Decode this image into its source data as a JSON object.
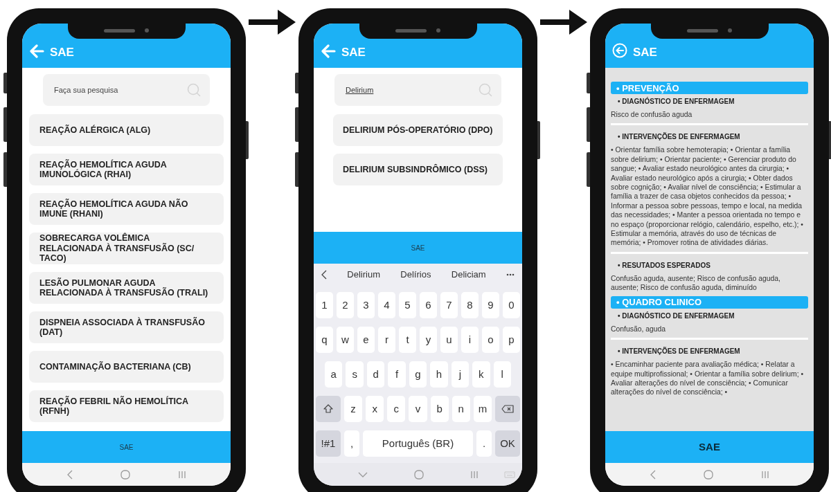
{
  "phones": [
    {
      "kind": "search_list",
      "header": {
        "title": "SAE"
      },
      "search": {
        "placeholder": "Faça sua pesquisa"
      },
      "items": [
        "REAÇÃO ALÉRGICA (ALG)",
        "REAÇÃO HEMOLÍTICA AGUDA IMUNOLÓGICA (RHAI)",
        "REAÇÃO HEMOLÍTICA AGUDA NÃO IMUNE (RHANI)",
        "SOBRECARGA VOLÊMICA RELACIONADA À TRANSFUSÃO (SC/ TACO)",
        "LESÃO PULMONAR AGUDA RELACIONADA À TRANSFUSÃO (TRALI)",
        "DISPNEIA ASSOCIADA À TRANSFUSÃO (DAT)",
        "CONTAMINAÇÃO BACTERIANA (CB)",
        "REAÇÃO FEBRIL NÃO HEMOLÍTICA (RFNH)"
      ],
      "bottom_bar": {
        "label": "SAE"
      }
    },
    {
      "kind": "search_keyboard",
      "header": {
        "title": "SAE"
      },
      "search": {
        "value": "Delirium"
      },
      "items": [
        "DELIRIUM PÓS-OPERATÓRIO (DPO)",
        "DELIRIUM SUBSINDRÔMICO (DSS)"
      ],
      "bottom_bar": {
        "label": "SAE"
      },
      "keyboard": {
        "suggestions": [
          "Delirium",
          "Delírios",
          "Deliciam"
        ],
        "rows": [
          [
            "1",
            "2",
            "3",
            "4",
            "5",
            "6",
            "7",
            "8",
            "9",
            "0"
          ],
          [
            "q",
            "w",
            "e",
            "r",
            "t",
            "y",
            "u",
            "i",
            "o",
            "p"
          ],
          [
            "a",
            "s",
            "d",
            "f",
            "g",
            "h",
            "j",
            "k",
            "l"
          ],
          [
            "z",
            "x",
            "c",
            "v",
            "b",
            "n",
            "m"
          ]
        ],
        "bottom_row": [
          {
            "label": "!#1",
            "kind": "function"
          },
          {
            "label": ",",
            "kind": "key"
          },
          {
            "label": "Português (BR)",
            "kind": "space"
          },
          {
            "label": ".",
            "kind": "key"
          },
          {
            "label": "OK",
            "kind": "enter"
          }
        ]
      }
    },
    {
      "kind": "detail",
      "header": {
        "title": "SAE"
      },
      "sections": [
        {
          "title": "• PREVENÇÃO",
          "blocks": [
            {
              "heading": "• DIAGNÓSTICO DE ENFERMAGEM",
              "text": "Risco de confusão aguda"
            },
            {
              "heading": "• INTERVENÇÕES DE ENFERMAGEM",
              "text": " • Orientar família sobre hemoterapia; • Orientar a família sobre delirium; • Orientar paciente; • Gerenciar produto do sangue; • Avaliar estado neurológico antes da cirurgia; • Avaliar estado neurológico após a cirurgia; • Obter dados sobre cognição; • Avaliar nível de consciência; • Estimular a família a trazer de casa objetos conhecidos da pessoa; • Informar a pessoa sobre pessoas, tempo e local, na medida das necessidades; • Manter a pessoa orientada no tempo e no espaço (proporcionar relógio, calendário, espelho, etc.); • Estimular a memória, através do uso de técnicas de memória; • Promover rotina de atividades diárias."
            },
            {
              "heading": "• RESUTADOS ESPERADOS",
              "text": "Confusão aguda, ausente; Risco de confusão aguda, ausente; Risco de confusão aguda, diminuído"
            }
          ]
        },
        {
          "title": "• QUADRO CLINICO",
          "blocks": [
            {
              "heading": "• DIAGNÓSTICO DE ENFERMAGEM",
              "text": "Confusão, aguda"
            },
            {
              "heading": "• INTERVENÇÕES DE ENFERMAGEM",
              "text": " • Encaminhar paciente para avaliação médica; • Relatar a equipe multiprofissional; • Orientar a família sobre delirium; • Avaliar alterações do nível de consciência; • Comunicar alterações do nível de consciência; •"
            }
          ]
        }
      ],
      "bottom_bar": {
        "label": "SAE"
      }
    }
  ]
}
